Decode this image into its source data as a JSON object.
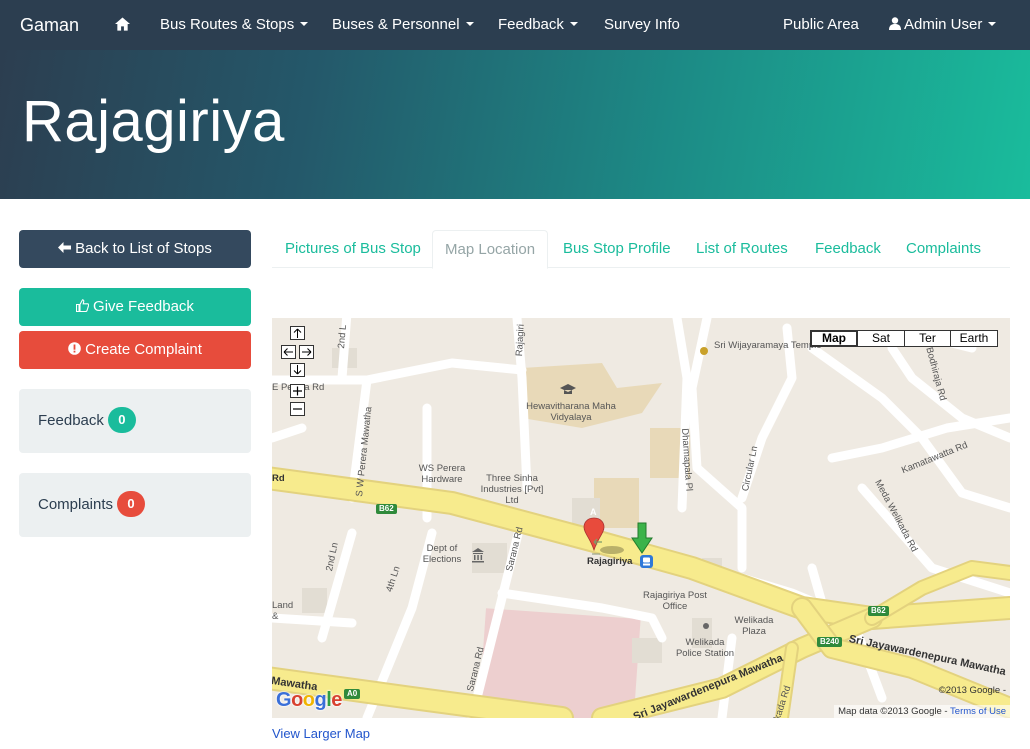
{
  "navbar": {
    "brand": "Gaman",
    "home_icon": "home-icon",
    "items": [
      {
        "label": "Bus Routes & Stops",
        "dropdown": true
      },
      {
        "label": "Buses & Personnel",
        "dropdown": true
      },
      {
        "label": "Feedback",
        "dropdown": true
      },
      {
        "label": "Survey Info",
        "dropdown": false
      }
    ],
    "public_area": "Public Area",
    "user": "Admin User",
    "user_icon": "user-icon"
  },
  "header": {
    "title": "Rajagiriya"
  },
  "sidebar": {
    "back_button": "Back to List of Stops",
    "give_feedback_button": "Give Feedback",
    "create_complaint_button": "Create Complaint",
    "feedback_label": "Feedback",
    "feedback_count": "0",
    "complaints_label": "Complaints",
    "complaints_count": "0"
  },
  "tabs": [
    {
      "label": "Pictures of Bus Stop",
      "active": false
    },
    {
      "label": "Map Location",
      "active": true
    },
    {
      "label": "Bus Stop Profile",
      "active": false
    },
    {
      "label": "List of Routes",
      "active": false
    },
    {
      "label": "Feedback",
      "active": false
    },
    {
      "label": "Complaints",
      "active": false
    }
  ],
  "map": {
    "types": [
      "Map",
      "Sat",
      "Ter",
      "Earth"
    ],
    "active_type": "Map",
    "places": {
      "temple": "Sri Wijayaramaya Temple",
      "school": "Hewavitharana Maha Vidyalaya",
      "hardware": "WS Perera Hardware",
      "industries": "Three Sinha Industries [Pvt] Ltd",
      "elections": "Dept of Elections",
      "bus_stop": "Rajagiriya",
      "post_office": "Rajagiriya Post Office",
      "plaza": "Welikada Plaza",
      "police": "Welikada Police Station",
      "land": "Land &"
    },
    "roads": {
      "second_lane_top": "2nd L",
      "rajagiriya_rd": "Rajagiri",
      "perera_rd": "E Perera Rd",
      "sw_perera": "S W Perera Mawatha",
      "dharmapala": "Dharmapala Pl",
      "circular": "Circular Ln",
      "bodhiraja": "Bodhiraja Rd",
      "kamatawatta": "Kamatawatta Rd",
      "meda_welikada": "Meda Welikada Rd",
      "rd_left": "Rd",
      "second_ln": "2nd Ln",
      "fourth_ln": "4th Ln",
      "sarana_top": "Sarana Rd",
      "sarana_bottom": "Sarana Rd",
      "jayawardene": "Sri Jayawardenepura Mawatha",
      "mawatha_left": "Mawatha",
      "welikada_rd": "kada Rd"
    },
    "shields": [
      "B62",
      "B62",
      "B240",
      "A0"
    ],
    "marker_a": "A",
    "copyright": "©2013 Google -",
    "map_data": "Map data ©2013 Google -",
    "terms": "Terms of Use",
    "google": "Google"
  },
  "view_larger_map": "View Larger Map",
  "colors": {
    "navbar": "#2c3e50",
    "turquoise": "#1abc9c",
    "alizarin": "#e74c3c",
    "wet_asphalt": "#34495e",
    "clouds": "#ecf0f1",
    "road_major": "#f7eb8d",
    "road_minor": "#ffffff",
    "map_land": "#efeae2"
  }
}
